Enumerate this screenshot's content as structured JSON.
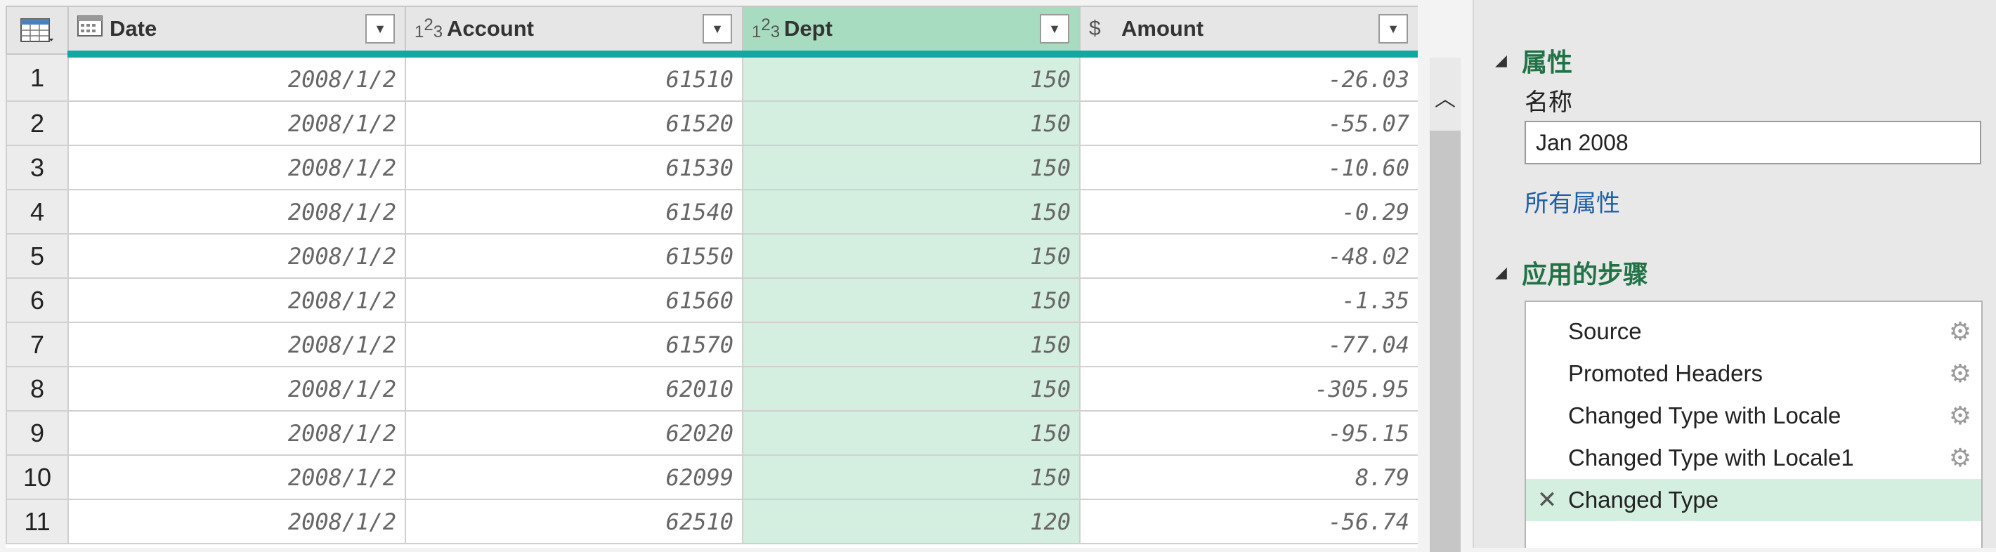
{
  "columns": [
    {
      "name": "Date",
      "type_icon": "calendar-table-icon"
    },
    {
      "name": "Account",
      "type_icon": "123"
    },
    {
      "name": "Dept",
      "type_icon": "123",
      "selected": true
    },
    {
      "name": "Amount",
      "type_icon": "$"
    }
  ],
  "rows": [
    {
      "n": "1",
      "date": "2008/1/2",
      "account": "61510",
      "dept": "150",
      "amount": "-26.03"
    },
    {
      "n": "2",
      "date": "2008/1/2",
      "account": "61520",
      "dept": "150",
      "amount": "-55.07"
    },
    {
      "n": "3",
      "date": "2008/1/2",
      "account": "61530",
      "dept": "150",
      "amount": "-10.60"
    },
    {
      "n": "4",
      "date": "2008/1/2",
      "account": "61540",
      "dept": "150",
      "amount": "-0.29"
    },
    {
      "n": "5",
      "date": "2008/1/2",
      "account": "61550",
      "dept": "150",
      "amount": "-48.02"
    },
    {
      "n": "6",
      "date": "2008/1/2",
      "account": "61560",
      "dept": "150",
      "amount": "-1.35"
    },
    {
      "n": "7",
      "date": "2008/1/2",
      "account": "61570",
      "dept": "150",
      "amount": "-77.04"
    },
    {
      "n": "8",
      "date": "2008/1/2",
      "account": "62010",
      "dept": "150",
      "amount": "-305.95"
    },
    {
      "n": "9",
      "date": "2008/1/2",
      "account": "62020",
      "dept": "150",
      "amount": "-95.15"
    },
    {
      "n": "10",
      "date": "2008/1/2",
      "account": "62099",
      "dept": "150",
      "amount": "8.79"
    },
    {
      "n": "11",
      "date": "2008/1/2",
      "account": "62510",
      "dept": "120",
      "amount": "-56.74"
    }
  ],
  "pane": {
    "properties_title": "属性",
    "name_label": "名称",
    "name_value": "Jan 2008",
    "all_properties_link": "所有属性",
    "steps_title": "应用的步骤",
    "steps": [
      {
        "label": "Source",
        "has_settings": true
      },
      {
        "label": "Promoted Headers",
        "has_settings": true
      },
      {
        "label": "Changed Type with Locale",
        "has_settings": true
      },
      {
        "label": "Changed Type with Locale1",
        "has_settings": true
      },
      {
        "label": "Changed Type",
        "has_settings": false,
        "active": true
      }
    ]
  },
  "colors": {
    "accent": "#217346",
    "selected_column": "#d4eee0",
    "header_underline": "#10a8a0",
    "link": "#1e5fa8"
  }
}
